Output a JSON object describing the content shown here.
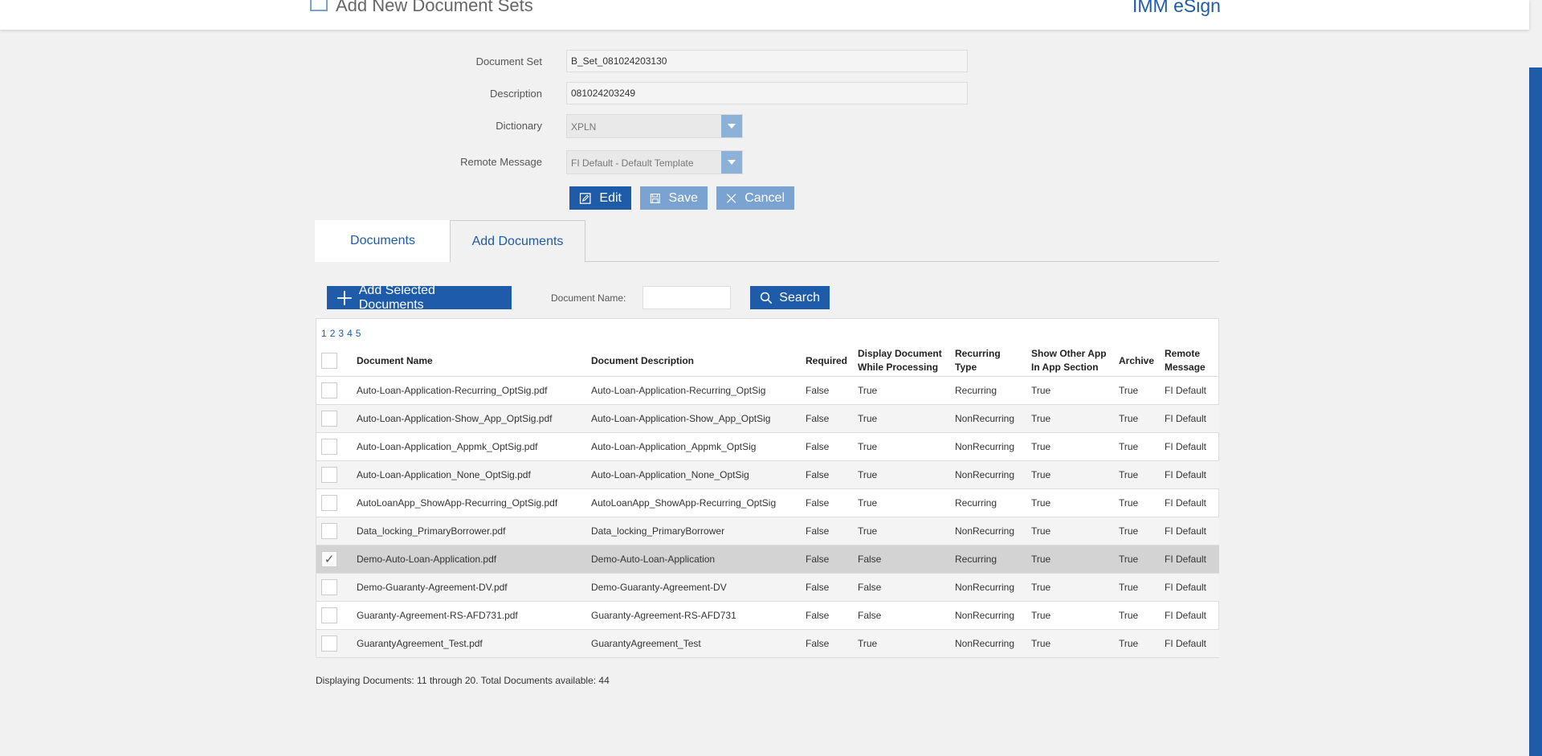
{
  "header": {
    "title": "Add New Document Sets",
    "brand": "IMM eSign"
  },
  "form": {
    "document_set_label": "Document Set",
    "document_set_value": "B_Set_081024203130",
    "description_label": "Description",
    "description_value": "081024203249",
    "dictionary_label": "Dictionary",
    "dictionary_value": "XPLN",
    "remote_message_label": "Remote Message",
    "remote_message_value": "FI Default - Default Template"
  },
  "actions": {
    "edit_label": "Edit",
    "save_label": "Save",
    "cancel_label": "Cancel"
  },
  "tabs": {
    "documents_label": "Documents",
    "add_documents_label": "Add Documents"
  },
  "toolbar": {
    "add_selected_label": "Add Selected Documents",
    "document_name_label": "Document Name:",
    "document_name_value": "",
    "search_label": "Search"
  },
  "pager": [
    "1",
    "2",
    "3",
    "4",
    "5"
  ],
  "columns": {
    "name": "Document Name",
    "description": "Document Description",
    "required": "Required",
    "display_l1": "Display Document",
    "display_l2": "While Processing",
    "recurring_l1": "Recurring",
    "recurring_l2": "Type",
    "show_l1": "Show Other App",
    "show_l2": "In App Section",
    "archive": "Archive",
    "remote_l1": "Remote",
    "remote_l2": "Message"
  },
  "rows": [
    {
      "checked": false,
      "name": "Auto-Loan-Application-Recurring_OptSig.pdf",
      "description": "Auto-Loan-Application-Recurring_OptSig",
      "required": "False",
      "display": "True",
      "recurring": "Recurring",
      "show": "True",
      "archive": "True",
      "remote": "FI Default"
    },
    {
      "checked": false,
      "name": "Auto-Loan-Application-Show_App_OptSig.pdf",
      "description": "Auto-Loan-Application-Show_App_OptSig",
      "required": "False",
      "display": "True",
      "recurring": "NonRecurring",
      "show": "True",
      "archive": "True",
      "remote": "FI Default"
    },
    {
      "checked": false,
      "name": "Auto-Loan-Application_Appmk_OptSig.pdf",
      "description": "Auto-Loan-Application_Appmk_OptSig",
      "required": "False",
      "display": "True",
      "recurring": "NonRecurring",
      "show": "True",
      "archive": "True",
      "remote": "FI Default"
    },
    {
      "checked": false,
      "name": "Auto-Loan-Application_None_OptSig.pdf",
      "description": "Auto-Loan-Application_None_OptSig",
      "required": "False",
      "display": "True",
      "recurring": "NonRecurring",
      "show": "True",
      "archive": "True",
      "remote": "FI Default"
    },
    {
      "checked": false,
      "name": "AutoLoanApp_ShowApp-Recurring_OptSig.pdf",
      "description": "AutoLoanApp_ShowApp-Recurring_OptSig",
      "required": "False",
      "display": "True",
      "recurring": "Recurring",
      "show": "True",
      "archive": "True",
      "remote": "FI Default"
    },
    {
      "checked": false,
      "name": "Data_locking_PrimaryBorrower.pdf",
      "description": "Data_locking_PrimaryBorrower",
      "required": "False",
      "display": "True",
      "recurring": "NonRecurring",
      "show": "True",
      "archive": "True",
      "remote": "FI Default"
    },
    {
      "checked": true,
      "name": "Demo-Auto-Loan-Application.pdf",
      "description": "Demo-Auto-Loan-Application",
      "required": "False",
      "display": "False",
      "recurring": "Recurring",
      "show": "True",
      "archive": "True",
      "remote": "FI Default"
    },
    {
      "checked": false,
      "name": "Demo-Guaranty-Agreement-DV.pdf",
      "description": "Demo-Guaranty-Agreement-DV",
      "required": "False",
      "display": "False",
      "recurring": "NonRecurring",
      "show": "True",
      "archive": "True",
      "remote": "FI Default"
    },
    {
      "checked": false,
      "name": "Guaranty-Agreement-RS-AFD731.pdf",
      "description": "Guaranty-Agreement-RS-AFD731",
      "required": "False",
      "display": "False",
      "recurring": "NonRecurring",
      "show": "True",
      "archive": "True",
      "remote": "FI Default"
    },
    {
      "checked": false,
      "name": "GuarantyAgreement_Test.pdf",
      "description": "GuarantyAgreement_Test",
      "required": "False",
      "display": "True",
      "recurring": "NonRecurring",
      "show": "True",
      "archive": "True",
      "remote": "FI Default"
    }
  ],
  "footer": {
    "summary": "Displaying Documents: 11 through 20. Total Documents available: 44"
  },
  "colors": {
    "primary": "#1e5ba8",
    "primary_light": "#7aa3d1",
    "selected_row": "#d3d3d3"
  }
}
